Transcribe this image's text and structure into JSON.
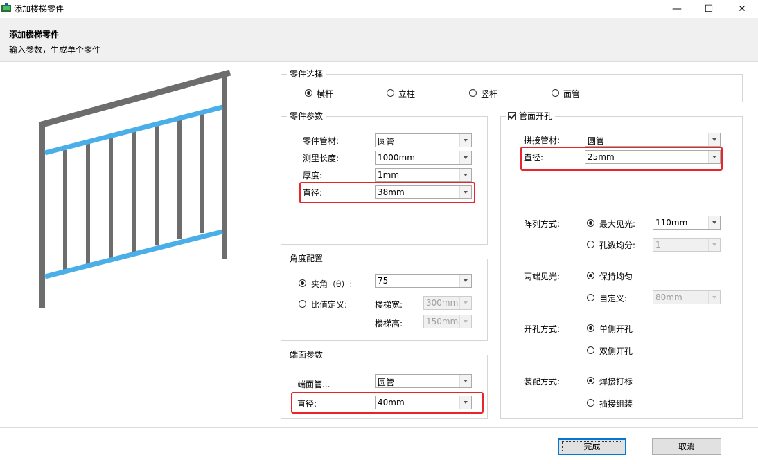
{
  "window": {
    "title": "添加楼梯零件",
    "minimize": "—",
    "maximize": "☐",
    "close": "✕"
  },
  "header": {
    "title": "添加楼梯零件",
    "subtitle": "输入参数，生成单个零件"
  },
  "part_select": {
    "legend": "零件选择",
    "options": [
      "横杆",
      "立柱",
      "竖杆",
      "面管"
    ],
    "selected": "横杆"
  },
  "part_params": {
    "legend": "零件参数",
    "material_label": "零件管材:",
    "material_value": "圆管",
    "length_label": "测里长度:",
    "length_value": "1000mm",
    "thickness_label": "厚度:",
    "thickness_value": "1mm",
    "diameter_label": "直径:",
    "diameter_value": "38mm"
  },
  "angle": {
    "legend": "角度配置",
    "angle_label": "夹角（θ）:",
    "angle_value": "75",
    "ratio_label": "比值定义:",
    "width_label": "楼梯宽:",
    "width_value": "300mm",
    "height_label": "楼梯高:",
    "height_value": "150mm"
  },
  "end_params": {
    "legend": "端面参数",
    "pipe_label": "端面管...",
    "pipe_value": "圆管",
    "diameter_label": "直径:",
    "diameter_value": "40mm"
  },
  "pipe_hole": {
    "legend": "管面开孔",
    "checked": true,
    "splice_label": "拼接管材:",
    "splice_value": "圆管",
    "diameter_label": "直径:",
    "diameter_value": "25mm",
    "array_label": "阵列方式:",
    "array_opt1": "最大见光:",
    "array_opt1_value": "110mm",
    "array_opt2": "孔数均分:",
    "array_opt2_value": "1",
    "ends_label": "两端见光:",
    "ends_opt1": "保持均匀",
    "ends_opt2": "自定义:",
    "ends_opt2_value": "80mm",
    "hole_label": "开孔方式:",
    "hole_opt1": "单侧开孔",
    "hole_opt2": "双侧开孔",
    "assembly_label": "装配方式:",
    "assembly_opt1": "焊接打标",
    "assembly_opt2": "插接组装"
  },
  "buttons": {
    "ok": "完成",
    "cancel": "取消"
  },
  "colors": {
    "rail_gray": "#6d6d6d",
    "rail_blue": "#4aaee8",
    "highlight": "#e8252b",
    "accent": "#0078d7"
  },
  "icons": {
    "app": "app-icon"
  }
}
